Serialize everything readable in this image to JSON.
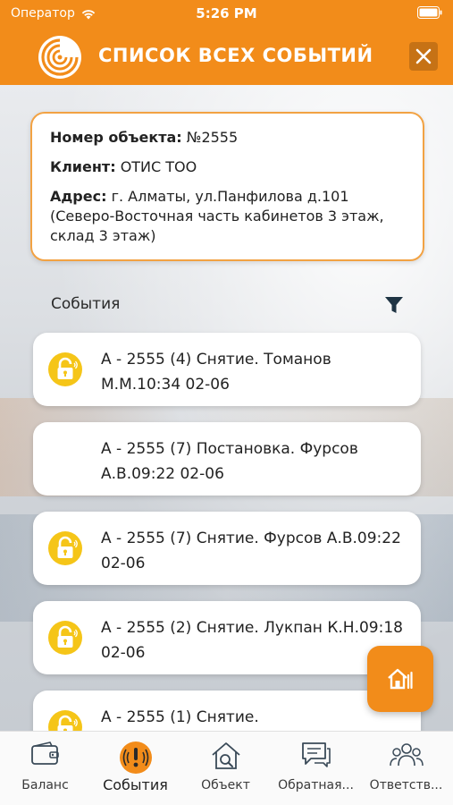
{
  "status_bar": {
    "carrier": "Оператор",
    "time": "5:26 PM"
  },
  "header": {
    "title": "СПИСОК ВСЕХ СОБЫТИЙ"
  },
  "object_info": {
    "number_label": "Номер объекта:",
    "number_value": "№2555",
    "client_label": "Клиент:",
    "client_value": "ОТИС ТОО",
    "address_label": "Адрес:",
    "address_value": "г. Алматы, ул.Панфилова д.101 (Северо-Восточная часть кабинетов 3 этаж, склад 3 этаж)"
  },
  "events": {
    "label": "События",
    "items": [
      {
        "text": "А - 2555 (4) Снятие. Томанов М.М.10:34 02-06",
        "icon": "unlock-icon"
      },
      {
        "text": "А - 2555 (7) Постановка. Фурсов А.В.09:22 02-06",
        "icon": ""
      },
      {
        "text": "А - 2555 (7) Снятие. Фурсов А.В.09:22 02-06",
        "icon": "unlock-icon"
      },
      {
        "text": "А - 2555 (2) Снятие. Лукпан К.Н.09:18 02-06",
        "icon": "unlock-icon"
      },
      {
        "text": "А - 2555 (1) Снятие.",
        "icon": "unlock-icon"
      }
    ]
  },
  "tabs": [
    {
      "label": "Баланс",
      "icon": "wallet-icon",
      "active": false
    },
    {
      "label": "События",
      "icon": "alarm-icon",
      "active": true
    },
    {
      "label": "Объект",
      "icon": "house-search-icon",
      "active": false
    },
    {
      "label": "Обратная...",
      "icon": "chat-icon",
      "active": false
    },
    {
      "label": "Ответств...",
      "icon": "people-icon",
      "active": false
    }
  ],
  "colors": {
    "brand": "#f28c1a",
    "card_border": "#f2a243",
    "icon_yellow": "#f5c518"
  }
}
